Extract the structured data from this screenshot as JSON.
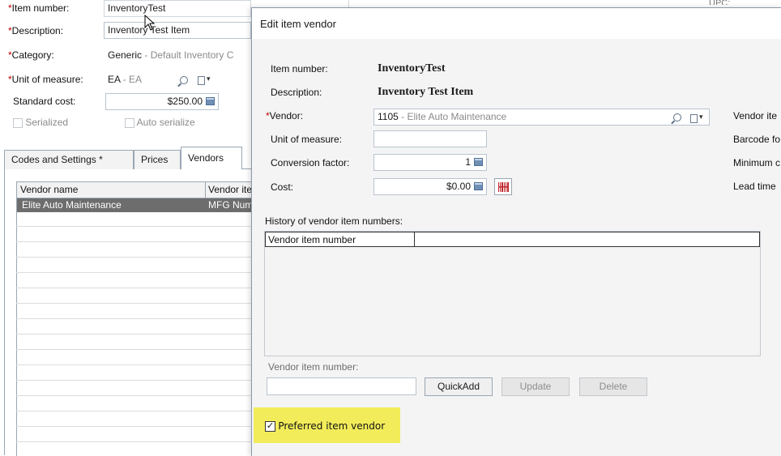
{
  "item": {
    "item_number_label": "Item number:",
    "item_number_value": "InventoryTest",
    "description_label": "Description:",
    "description_value": "Inventory Test Item",
    "category_label": "Category:",
    "category_code": "Generic",
    "category_desc": " - Default Inventory C",
    "uom_label": "Unit of measure:",
    "uom_code": "EA",
    "uom_desc": " - EA",
    "standard_cost_label": "Standard cost:",
    "standard_cost_value": "$250.00",
    "serialized_label": "Serialized",
    "auto_serialize_label": "Auto serialize",
    "upc_label": "UPC:"
  },
  "tabs": [
    {
      "label": "Codes and Settings *"
    },
    {
      "label": "Prices"
    },
    {
      "label": "Vendors"
    }
  ],
  "vendors_grid": {
    "col_vendor_name": "Vendor name",
    "col_vendor_item": "Vendor ite",
    "rows": [
      {
        "vendor_name": "Elite Auto Maintenance",
        "vendor_item": "MFG Num"
      }
    ]
  },
  "dialog": {
    "title": "Edit item vendor",
    "item_number_label": "Item number:",
    "item_number_value": "InventoryTest",
    "description_label": "Description:",
    "description_value": "Inventory Test Item",
    "vendor_label": "Vendor:",
    "vendor_code": "1105",
    "vendor_desc": " - Elite Auto Maintenance",
    "uom_label": "Unit of measure:",
    "uom_value": "",
    "conversion_label": "Conversion factor:",
    "conversion_value": "1",
    "cost_label": "Cost:",
    "cost_value": "$0.00",
    "right_labels": [
      "Vendor ite",
      "Barcode fo",
      "Minimum c",
      "Lead time"
    ],
    "history_label": "History of vendor item numbers:",
    "history_col": "Vendor item number",
    "vendor_item_number_label": "Vendor item number:",
    "vendor_item_number_value": "",
    "quickadd_label": "QuickAdd",
    "update_label": "Update",
    "delete_label": "Delete",
    "preferred_label": "Preferred item vendor",
    "preferred_checked": "✓"
  },
  "colors": {
    "highlight": "#f2ec5a",
    "selected_row": "#6d6d6d",
    "dialog_bg": "#f4f4f4"
  }
}
